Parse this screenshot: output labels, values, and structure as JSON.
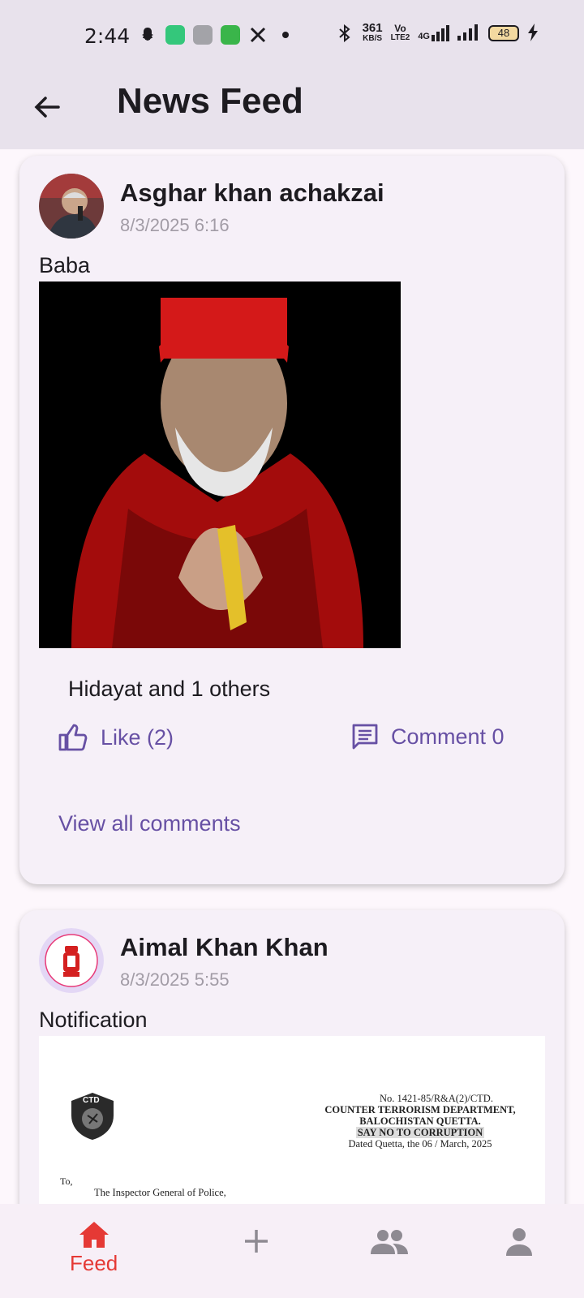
{
  "status_bar": {
    "time": "2:44",
    "speed_top": "361",
    "speed_bottom": "KB/S",
    "net1_top": "Vo",
    "net1_bottom": "LTE2",
    "net2": "4G",
    "battery": "48"
  },
  "app_bar": {
    "title": "News Feed",
    "back_icon": "arrow-left-icon"
  },
  "posts": [
    {
      "author": "Asghar khan achakzai",
      "time": "8/3/2025 6:16",
      "text": "Baba",
      "likers": "Hidayat and 1 others",
      "like_label": "Like (2)",
      "comment_label": "Comment 0",
      "view_comments": "View all comments"
    },
    {
      "author": "Aimal Khan Khan",
      "time": "8/3/2025 5:55",
      "text": "Notification",
      "document": {
        "no_line": "No. 1421-85/R&A(2)/CTD.",
        "dept": "COUNTER TERRORISM DEPARTMENT,",
        "city": "BALOCHISTAN QUETTA.",
        "slogan": "SAY NO TO CORRUPTION",
        "dated": "Dated Quetta, the 06 / March, 2025",
        "to": "To,",
        "recipient": "The Inspector General of Police,",
        "badge": "CTD"
      }
    }
  ],
  "bottom_nav": {
    "feed_label": "Feed",
    "active_color": "#e53935",
    "inactive_color": "#8e8a92"
  },
  "colors": {
    "accent": "#6750a4",
    "card_bg": "#f6f0f8",
    "appbar_bg": "#e8e2ec"
  }
}
